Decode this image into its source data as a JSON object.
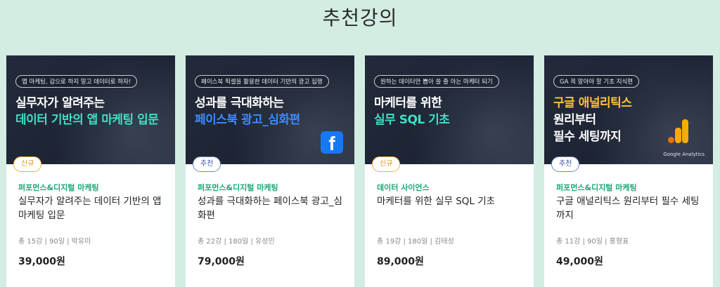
{
  "section": {
    "title": "추천강의"
  },
  "colors": {
    "background": "#d3ede3",
    "category": "#1aa77a",
    "thumb_bg": "#1d2433"
  },
  "courses": [
    {
      "thumb": {
        "pill": "앱 마케팅, 감으로 하지 말고 데이터로 하자!",
        "line1": "실무자가 알려주는",
        "line2": "데이터 기반의 앱 마케팅 입문",
        "line3": ""
      },
      "badge": "신규",
      "category": "퍼포먼스&디지털 마케팅",
      "title": "실무자가 알려주는 데이터 기반의 앱 마케팅 입문",
      "meta": "총 15강 | 90일 | 박유미",
      "price": "39,000원"
    },
    {
      "thumb": {
        "pill": "페이스북 픽셀을 활용한 데이터 기반의 광고 집행",
        "line1": "성과를 극대화하는",
        "line2": "페이스북 광고_심화편",
        "line3": "",
        "logo": "f",
        "logo_icon": "facebook-icon"
      },
      "badge": "추천",
      "category": "퍼포먼스&디지털 마케팅",
      "title": "성과를 극대화하는 페이스북 광고_심화편",
      "meta": "총 22강 | 180일 | 유성민",
      "price": "79,000원"
    },
    {
      "thumb": {
        "pill": "원하는 데이터만 뽑아 쓸 줄 아는 마케터 되기",
        "line1": "마케터를 위한",
        "line2": "실무 SQL 기초",
        "line3": ""
      },
      "badge": "신규",
      "category": "데이터 사이언스",
      "title": "마케터를 위한 실무 SQL 기초",
      "meta": "총 19강 | 180일 | 김태성",
      "price": "89,000원"
    },
    {
      "thumb": {
        "pill": "GA 꼭 알아야 할 기초 지식편",
        "line1": "구글 애널리틱스",
        "line2": "원리부터",
        "line3": "필수 세팅까지",
        "logo": "Google Analytics",
        "logo_icon": "google-analytics-icon"
      },
      "badge": "추천",
      "category": "퍼포먼스&디지털 마케팅",
      "title": "구글 애널리틱스 원리부터 필수 세팅까지",
      "meta": "총 11강 | 90일 | 홍형표",
      "price": "49,000원"
    }
  ]
}
